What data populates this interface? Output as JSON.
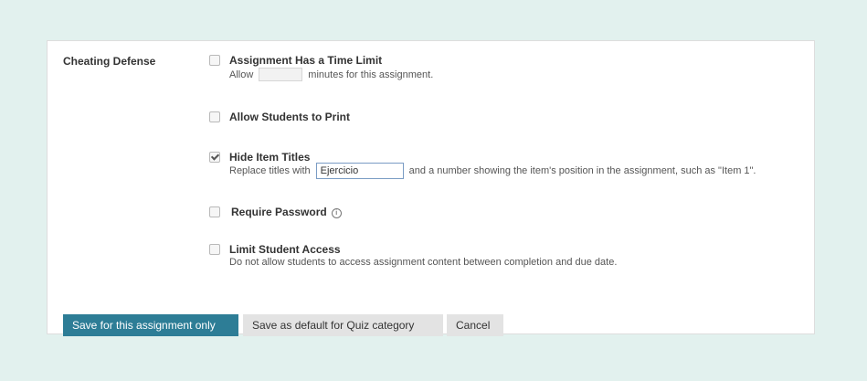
{
  "section_label": "Cheating Defense",
  "options": [
    {
      "title": "Assignment Has a Time Limit",
      "checked": false,
      "desc_prefix": "Allow",
      "desc_suffix": "minutes for this assignment."
    },
    {
      "title": "Allow Students to Print",
      "checked": false
    },
    {
      "title": "Hide Item Titles",
      "checked": true,
      "desc_prefix": "Replace titles with",
      "input_value": "Ejercicio",
      "desc_suffix": "and a number showing the item's position in the assignment, such as \"Item 1\"."
    },
    {
      "title": "Require Password",
      "checked": false,
      "info_icon": "info-icon"
    },
    {
      "title": "Limit Student Access",
      "checked": false,
      "desc": "Do not allow students to access assignment content between completion and due date."
    }
  ],
  "buttons": {
    "save_assignment": "Save for this assignment only",
    "save_default": "Save as default for Quiz category",
    "cancel": "Cancel"
  },
  "colors": {
    "background": "#e2f1ee",
    "primary_button": "#2d7d96",
    "secondary_button": "#e3e3e3"
  }
}
